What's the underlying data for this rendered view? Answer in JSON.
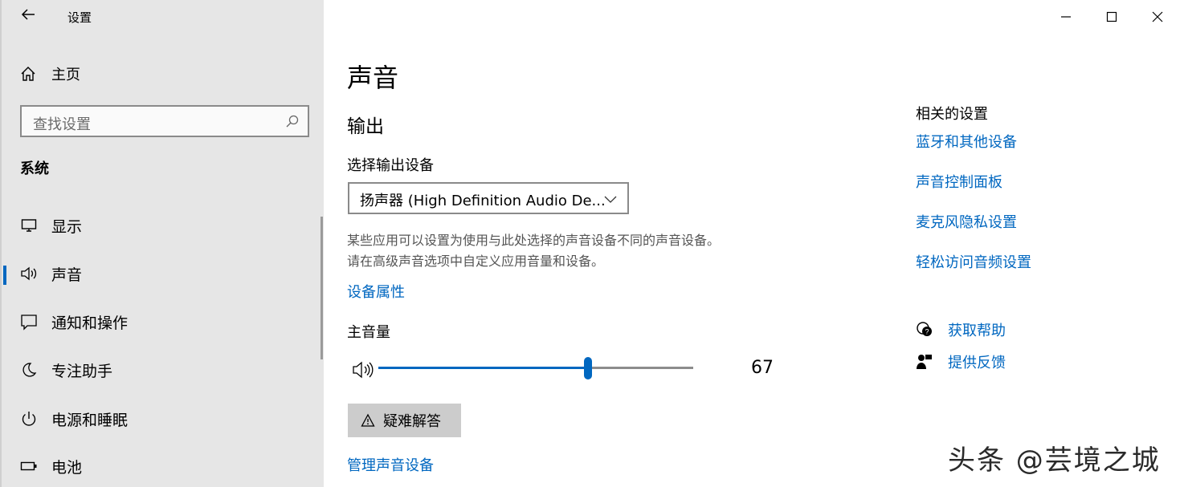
{
  "window": {
    "title": "设置",
    "back_icon": "back-arrow-icon",
    "controls": [
      "minimize-icon",
      "maximize-icon",
      "close-icon"
    ]
  },
  "sidebar": {
    "home_label": "主页",
    "search_placeholder": "查找设置",
    "section_title": "系统",
    "items": [
      {
        "label": "显示",
        "icon": "display-icon",
        "active": false
      },
      {
        "label": "声音",
        "icon": "speaker-icon",
        "active": true
      },
      {
        "label": "通知和操作",
        "icon": "notification-icon",
        "active": false
      },
      {
        "label": "专注助手",
        "icon": "moon-icon",
        "active": false
      },
      {
        "label": "电源和睡眠",
        "icon": "power-icon",
        "active": false
      },
      {
        "label": "电池",
        "icon": "battery-icon",
        "active": false
      }
    ]
  },
  "main": {
    "title": "声音",
    "output_heading": "输出",
    "choose_device_label": "选择输出设备",
    "device_value": "扬声器 (High Definition Audio De...",
    "description_line1": "某些应用可以设置为使用与此处选择的声音设备不同的声音设备。",
    "description_line2": "请在高级声音选项中自定义应用音量和设备。",
    "device_properties_link": "设备属性",
    "master_volume_label": "主音量",
    "volume_value": "67",
    "troubleshoot_button": "疑难解答",
    "manage_devices_link": "管理声音设备"
  },
  "related": {
    "title": "相关的设置",
    "links": [
      "蓝牙和其他设备",
      "声音控制面板",
      "麦克风隐私设置",
      "轻松访问音频设置"
    ],
    "get_help": "获取帮助",
    "give_feedback": "提供反馈"
  },
  "watermark": {
    "text": "头条 @芸境之城"
  },
  "colors": {
    "accent": "#0067c0",
    "sidebar_bg": "#e6e6e6"
  }
}
